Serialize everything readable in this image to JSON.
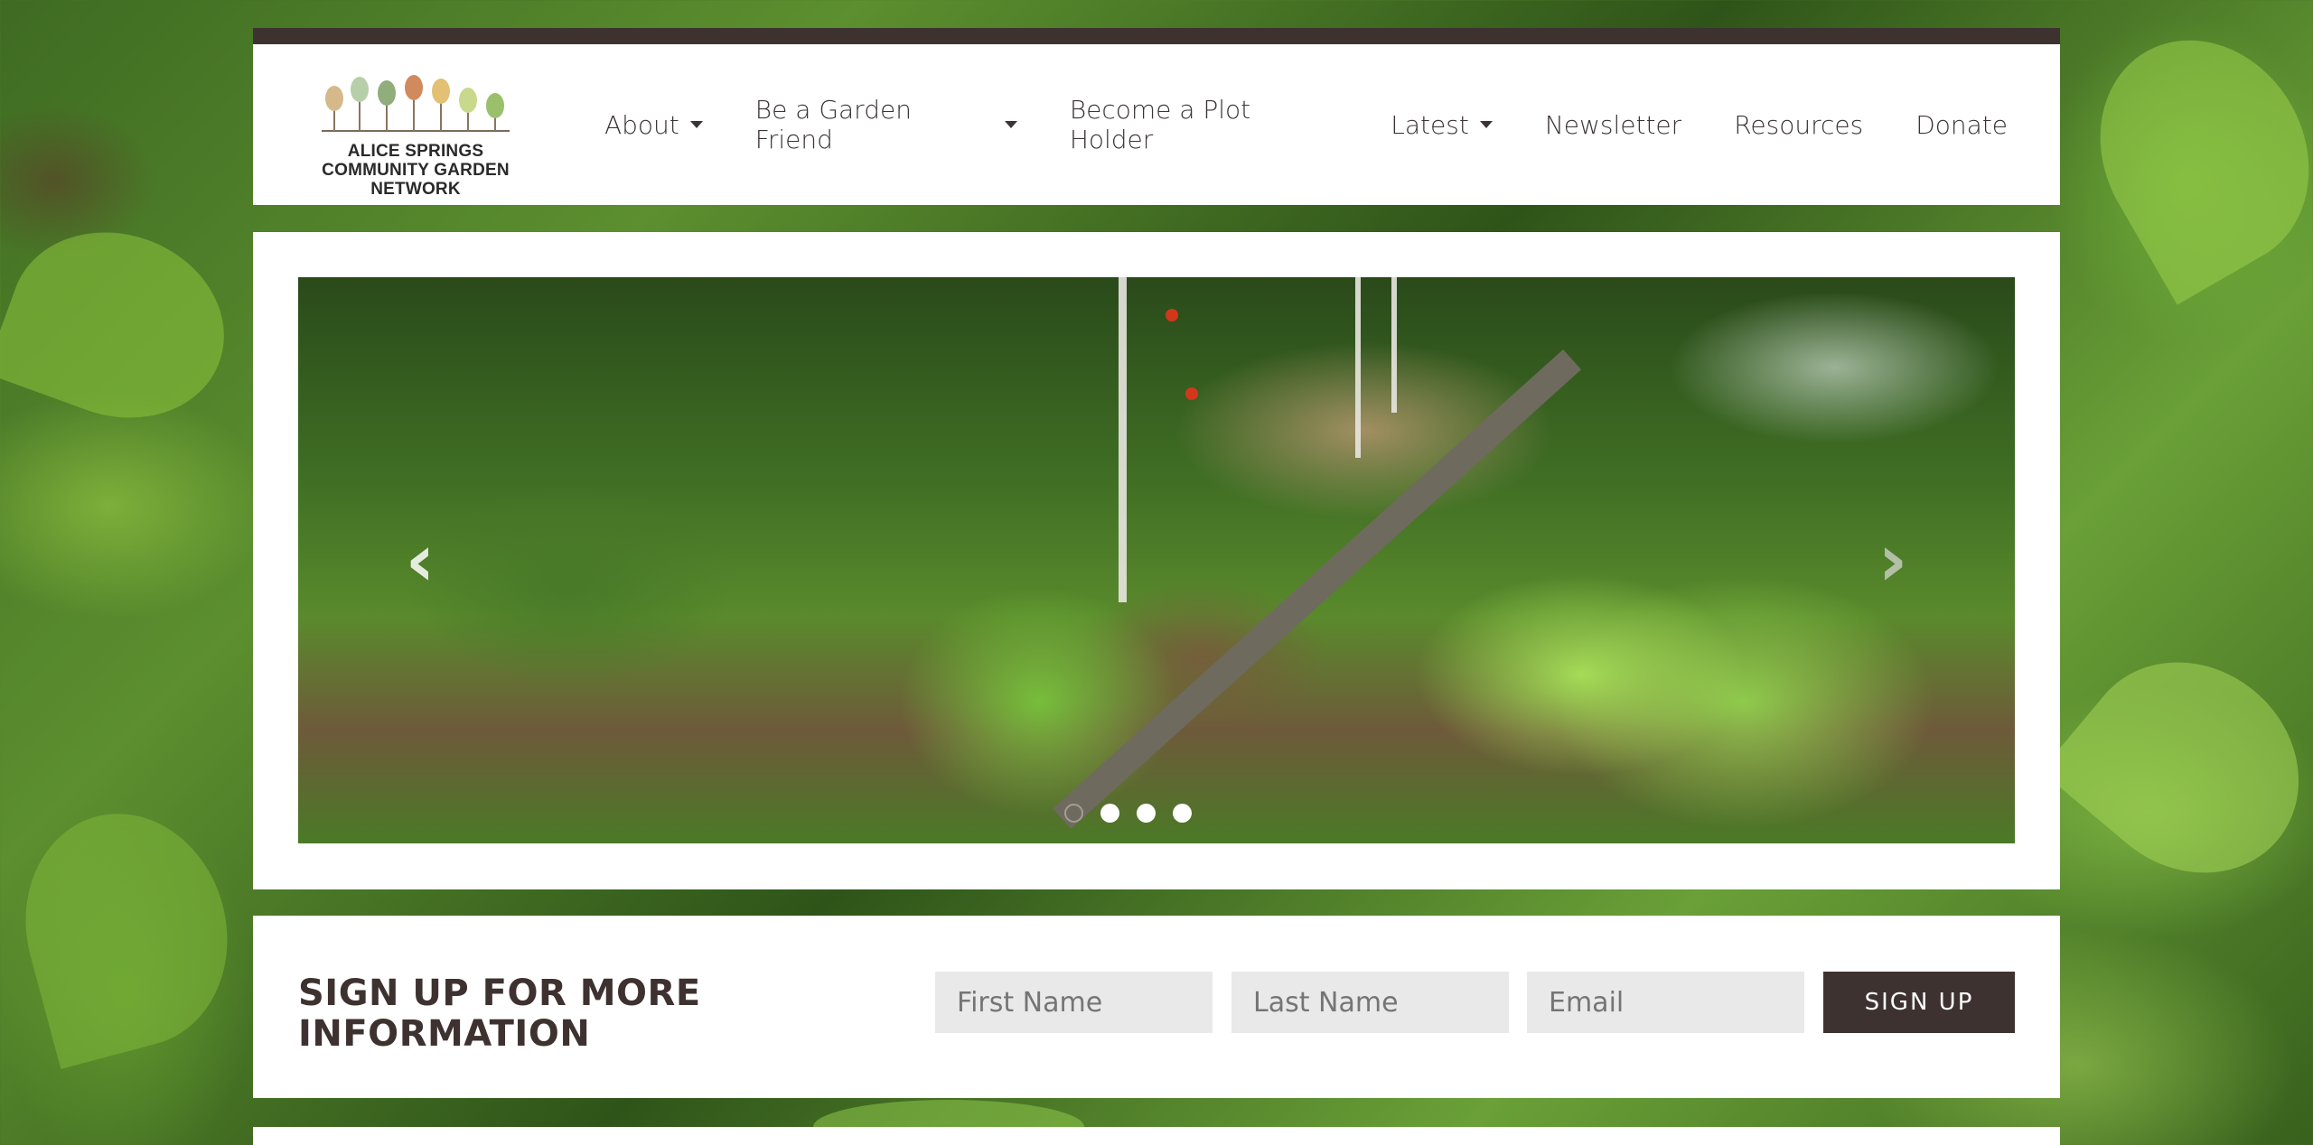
{
  "logo": {
    "lines": [
      "ALICE SPRINGS",
      "COMMUNITY GARDEN",
      "NETWORK"
    ],
    "tree_colors": [
      "#d6b98a",
      "#b6cfa8",
      "#8fae7b",
      "#d08a5e",
      "#e3c074",
      "#c9d98c",
      "#9bbf6a"
    ]
  },
  "nav": {
    "items": [
      {
        "label": "About",
        "dropdown": true
      },
      {
        "label": "Be a Garden Friend",
        "dropdown": true
      },
      {
        "label": "Become a Plot Holder",
        "dropdown": false
      },
      {
        "label": "Latest",
        "dropdown": true
      },
      {
        "label": "Newsletter",
        "dropdown": false
      },
      {
        "label": "Resources",
        "dropdown": false
      },
      {
        "label": "Donate",
        "dropdown": false
      }
    ]
  },
  "slider": {
    "prev_glyph": "‹",
    "next_glyph": "›",
    "slide_count": 4,
    "active_index": 0
  },
  "signup": {
    "title": "SIGN UP FOR MORE INFORMATION",
    "first_name_placeholder": "First Name",
    "last_name_placeholder": "Last Name",
    "email_placeholder": "Email",
    "button_label": "SIGN UP"
  },
  "colors": {
    "brand_dark": "#3e3231",
    "panel": "#ffffff",
    "field_bg": "#e9e9e9"
  }
}
